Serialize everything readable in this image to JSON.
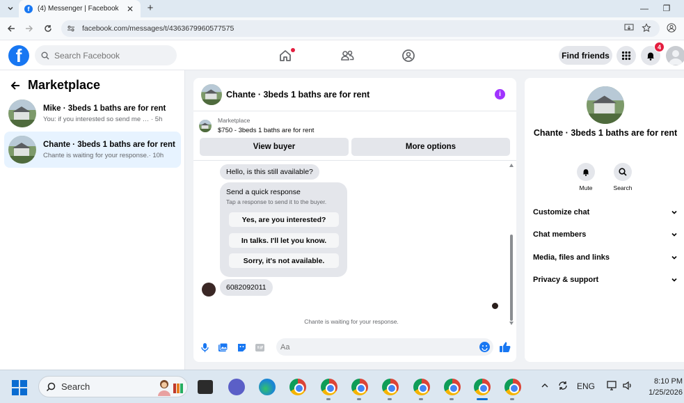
{
  "browser": {
    "tab_title": "(4) Messenger | Facebook",
    "tab_favicon": "f",
    "url": "facebook.com/messages/t/4363679960577575"
  },
  "header": {
    "search_placeholder": "Search Facebook",
    "find_friends": "Find friends",
    "notification_count": "4",
    "logo_letter": "f"
  },
  "sidebar": {
    "title": "Marketplace",
    "conversations": [
      {
        "name": "Mike · 3beds 1 baths are for rent",
        "preview": "You: if you interested so send me nu...",
        "time": " · 5h"
      },
      {
        "name": "Chante · 3beds 1 baths are for rent",
        "preview": "Chante is waiting for your response.",
        "time": " · 10h"
      }
    ]
  },
  "chat": {
    "title": "Chante · 3beds 1 baths are for rent",
    "info_glyph": "i",
    "marketplace_label": "Marketplace",
    "listing": "$750 - 3beds 1 baths are for rent",
    "view_buyer": "View buyer",
    "more_options": "More options",
    "messages": {
      "incoming_1": "Hello, is this still available?",
      "quick_title": "Send a quick response",
      "quick_sub": "Tap a response to send it to the buyer.",
      "quick_options": [
        "Yes, are you interested?",
        "In talks. I'll let you know.",
        "Sorry, it's not available."
      ],
      "incoming_2": "6082092011"
    },
    "waiting": "Chante is waiting for your response.",
    "composer_placeholder": "Aa"
  },
  "details": {
    "name": "Chante · 3beds 1 baths are for rent",
    "mute": "Mute",
    "search": "Search",
    "items": [
      "Customize chat",
      "Chat members",
      "Media, files and links",
      "Privacy & support"
    ]
  },
  "taskbar": {
    "search": "Search",
    "lang": "ENG",
    "time": "8:10 PM",
    "date": "1/25/2026"
  },
  "colors": {
    "fb_blue": "#1877f2",
    "active_conv": "#e7f3ff",
    "badge_red": "#e41e3f",
    "info_purple": "#a033ff"
  }
}
